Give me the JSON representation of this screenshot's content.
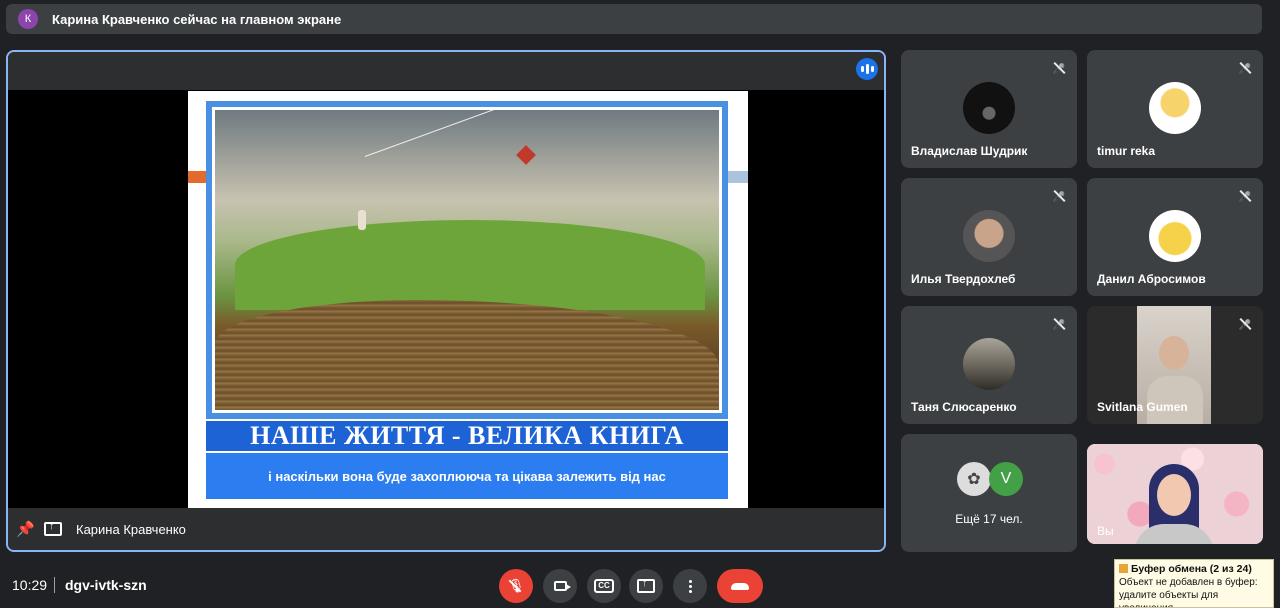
{
  "notification": {
    "avatar_letter": "К",
    "text": "Карина Кравченко сейчас на главном экране"
  },
  "presentation": {
    "presenter_name": "Карина Кравченко",
    "slide_title": "НАШЕ  ЖИТТЯ - ВЕЛИКА КНИГА",
    "slide_subtitle": "і наскільки вона буде захоплююча та цікава залежить від нас",
    "icons": [
      "pin-icon",
      "present-screen-icon",
      "speaking-indicator-icon"
    ]
  },
  "participants": [
    {
      "name": "Владислав Шудрик",
      "muted": true
    },
    {
      "name": "timur reka",
      "muted": true
    },
    {
      "name": "Илья Твердохлеб",
      "muted": true
    },
    {
      "name": "Данил Абросимов",
      "muted": true
    },
    {
      "name": "Таня Слюсаренко",
      "muted": true
    },
    {
      "name": "Svitlana Gumen",
      "muted": true
    }
  ],
  "more_participants": {
    "label": "Ещё 17 чел.",
    "avatar_letter": "V"
  },
  "self_tile": {
    "label": "Вы"
  },
  "bottom_bar": {
    "time": "10:29",
    "meeting_code": "dgv-ivtk-szn",
    "buttons": [
      "mic-off",
      "camera",
      "captions",
      "present",
      "more",
      "end-call"
    ],
    "captions_label": "CC"
  },
  "clipboard_toast": {
    "title": "Буфер обмена (2 из 24)",
    "line1": "Объект не добавлен в буфер:",
    "line2": "удалите объекты для увеличения"
  },
  "colors": {
    "accent": "#8ab4f8",
    "end_call": "#ea4335",
    "background": "#202124",
    "tile": "#3c4043"
  }
}
